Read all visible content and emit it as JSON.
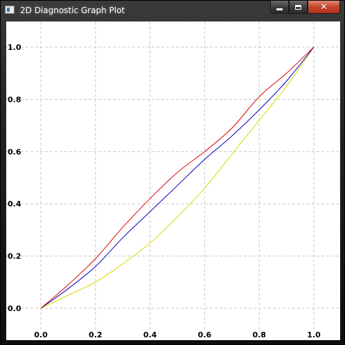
{
  "window": {
    "title": "2D Diagnostic Graph Plot",
    "controls": {
      "minimize": "minimize-icon",
      "maximize": "maximize-icon",
      "close": "✕"
    }
  },
  "colors": {
    "series_red": "#e00000",
    "series_blue": "#0000c0",
    "series_yellow": "#d8d800",
    "grid": "#c8c8c8"
  },
  "chart_data": {
    "type": "line",
    "title": "",
    "xlabel": "",
    "ylabel": "",
    "xlim": [
      0,
      1
    ],
    "ylim": [
      0,
      1
    ],
    "grid": true,
    "x_ticks": [
      "0.0",
      "0.2",
      "0.4",
      "0.6",
      "0.8",
      "1.0"
    ],
    "y_ticks": [
      "0.0",
      "0.2",
      "0.4",
      "0.6",
      "0.8",
      "1.0"
    ],
    "series": [
      {
        "color": "#e00000",
        "x": [
          0,
          0.1,
          0.2,
          0.3,
          0.4,
          0.5,
          0.6,
          0.7,
          0.8,
          0.9,
          1.0
        ],
        "y": [
          0,
          0.09,
          0.19,
          0.31,
          0.42,
          0.52,
          0.6,
          0.69,
          0.81,
          0.9,
          1.0
        ]
      },
      {
        "color": "#0000c0",
        "x": [
          0,
          0.1,
          0.2,
          0.3,
          0.4,
          0.5,
          0.6,
          0.7,
          0.8,
          0.9,
          1.0
        ],
        "y": [
          0,
          0.075,
          0.16,
          0.27,
          0.37,
          0.47,
          0.57,
          0.66,
          0.76,
          0.87,
          1.0
        ]
      },
      {
        "color": "#d8d800",
        "x": [
          0,
          0.1,
          0.2,
          0.3,
          0.4,
          0.5,
          0.6,
          0.7,
          0.8,
          0.9,
          1.0
        ],
        "y": [
          0,
          0.05,
          0.1,
          0.17,
          0.25,
          0.35,
          0.46,
          0.59,
          0.72,
          0.85,
          1.0
        ]
      }
    ]
  }
}
